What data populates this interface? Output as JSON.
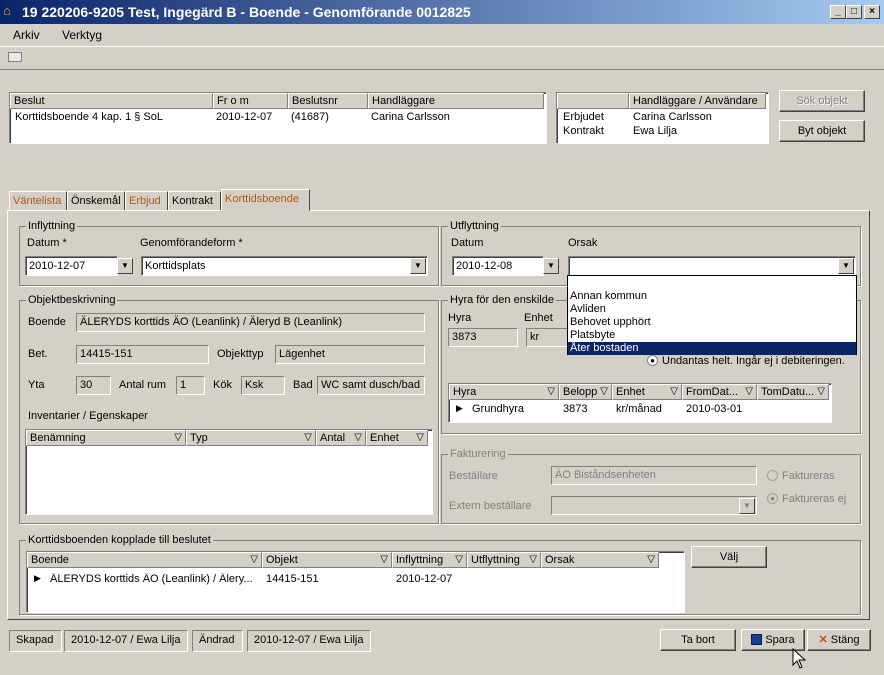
{
  "window": {
    "title": "19 220206-9205  Test, Ingegärd B  -  Boende - Genomförande  0012825"
  },
  "menu": {
    "items": [
      "Arkiv",
      "Verktyg"
    ]
  },
  "beslut_table": {
    "headers": [
      "Beslut",
      "Fr o m",
      "Beslutsnr",
      "Handläggare"
    ],
    "rows": [
      [
        "Korttidsboende  4 kap. 1 § SoL",
        "2010-12-07",
        "(41687)",
        "Carina Carlsson"
      ]
    ]
  },
  "handlaggare_table": {
    "headers": [
      "",
      "Handläggare / Användare"
    ],
    "rows": [
      [
        "Erbjudet",
        "Carina Carlsson"
      ],
      [
        "Kontrakt",
        "Ewa Lilja"
      ]
    ]
  },
  "buttons": {
    "sok_objekt": "Sök objekt",
    "byt_objekt": "Byt objekt",
    "valj": "Välj",
    "ta_bort": "Ta bort",
    "spara": "Spara",
    "stang": "Stäng"
  },
  "tabs": [
    "Väntelista",
    "Önskemål",
    "Erbjud",
    "Kontrakt",
    "Korttidsboende"
  ],
  "inflyttning": {
    "title": "Inflyttning",
    "datum_label": "Datum *",
    "datum": "2010-12-07",
    "form_label": "Genomförandeform *",
    "form": "Korttidsplats"
  },
  "utflyttning": {
    "title": "Utflyttning",
    "datum_label": "Datum",
    "datum": "2010-12-08",
    "orsak_label": "Orsak",
    "orsak": "",
    "options": [
      "Annan kommun",
      "Avliden",
      "Behovet upphört",
      "Platsbyte",
      "Åter bostaden"
    ],
    "selected": "Åter bostaden"
  },
  "objekt": {
    "title": "Objektbeskrivning",
    "boende_label": "Boende",
    "boende": "ÄLERYDS korttids ÄO (Leanlink) / Äleryd B (Leanlink)",
    "bet_label": "Bet.",
    "bet": "14415-151",
    "objekttyp_label": "Objekttyp",
    "objekttyp": "Lägenhet",
    "yta_label": "Yta",
    "yta": "30",
    "antal_rum_label": "Antal rum",
    "antal_rum": "1",
    "kok_label": "Kök",
    "kok": "Ksk",
    "bad_label": "Bad",
    "bad": "WC samt dusch/bad",
    "inventarier_label": "Inventarier / Egenskaper",
    "inv_headers": [
      "Benämning",
      "Typ",
      "Antal",
      "Enhet"
    ]
  },
  "hyra": {
    "title": "Hyra för den enskilde",
    "hyra_label": "Hyra",
    "hyra": "3873",
    "enhet_label": "Enhet",
    "enhet": "kr",
    "undantas": "Undantas helt. Ingår ej i debiteringen.",
    "headers": [
      "Hyra",
      "Belopp",
      "Enhet",
      "FromDat...",
      "TomDatu..."
    ],
    "rows": [
      [
        "Grundhyra",
        "3873",
        "kr/månad",
        "2010-03-01",
        ""
      ]
    ]
  },
  "fakturering": {
    "title": "Fakturering",
    "bestallare_label": "Beställare",
    "bestallare": "ÄO Biståndsenheten",
    "extern_label": "Extern beställare",
    "extern": "",
    "faktureras": "Faktureras",
    "faktureras_ej": "Faktureras ej"
  },
  "kopplade": {
    "title": "Korttidsboenden kopplade till beslutet",
    "headers": [
      "Boende",
      "Objekt",
      "Inflyttning",
      "Utflyttning",
      "Orsak"
    ],
    "rows": [
      [
        "ÄLERYDS korttids ÄO (Leanlink) / Älery...",
        "14415-151",
        "2010-12-07",
        "",
        ""
      ]
    ]
  },
  "status": {
    "skapad_label": "Skapad",
    "skapad": "2010-12-07 / Ewa Lilja",
    "andrad_label": "Ändrad",
    "andrad": "2010-12-07 / Ewa Lilja"
  }
}
